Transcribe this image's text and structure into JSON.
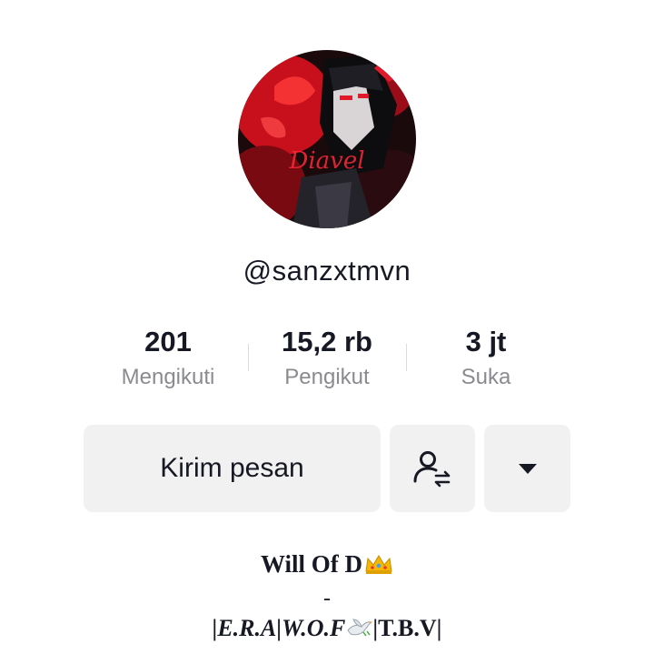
{
  "profile": {
    "username": "@sanzxtmvn",
    "avatar_icon": "anime-avatar-red-black"
  },
  "stats": [
    {
      "value": "201",
      "label": "Mengikuti"
    },
    {
      "value": "15,2 rb",
      "label": "Pengikut"
    },
    {
      "value": "3 jt",
      "label": "Suka"
    }
  ],
  "actions": {
    "message_label": "Kirim pesan",
    "follow_icon": "follow-swap-icon",
    "more_icon": "dropdown-triangle-icon"
  },
  "bio": {
    "line1": "Will Of D",
    "line1_emoji": "crown-icon",
    "line2": "-",
    "line3_part1": "|E.R.A|W.O.F",
    "line3_emoji": "dove-icon",
    "line3_part2": "|T.B.V|"
  },
  "colors": {
    "text": "#161823",
    "secondary_text": "#8a8b91",
    "button_bg": "#f1f1f2",
    "avatar_red": "#d0021b"
  }
}
